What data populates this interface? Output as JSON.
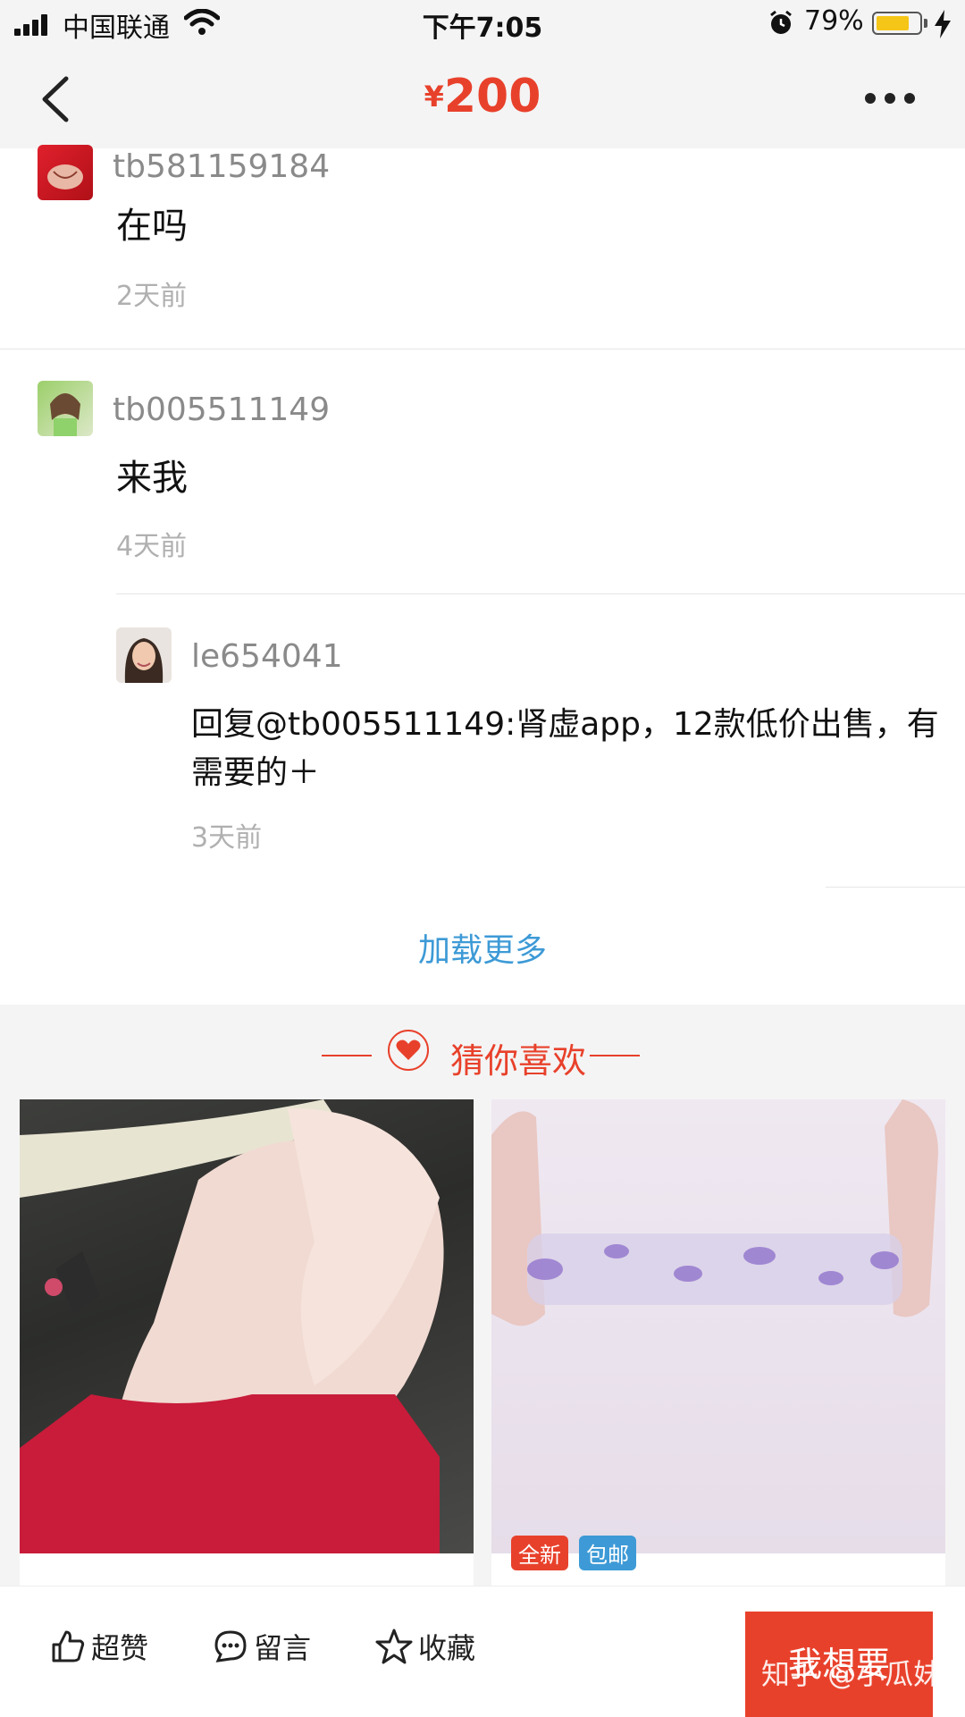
{
  "status_bar": {
    "carrier": "中国联通",
    "time": "下午7:05",
    "battery_percent": "79%",
    "battery_level": 0.79
  },
  "nav": {
    "currency": "¥",
    "price": "200"
  },
  "comments": [
    {
      "username": "tb581159184",
      "text": "在吗",
      "time": "2天前"
    },
    {
      "username": "tb005511149",
      "text": "来我",
      "time": "4天前"
    },
    {
      "username": "le654041",
      "text": "回复@tb005511149:肾虚app，12款低价出售，有需要的＋",
      "time": "3天前"
    }
  ],
  "load_more": "加载更多",
  "recommend": {
    "title": "猜你喜欢",
    "tags": [
      "全新",
      "包邮"
    ]
  },
  "bottom_bar": {
    "like": "超赞",
    "comment": "留言",
    "favorite": "收藏",
    "want": "我想要"
  },
  "watermark": "知乎 @小瓜妹",
  "colors": {
    "accent": "#e8412b",
    "link": "#3d9ad6",
    "tag_new": "#e8412b",
    "tag_free_shipping": "#3d9ad6"
  }
}
